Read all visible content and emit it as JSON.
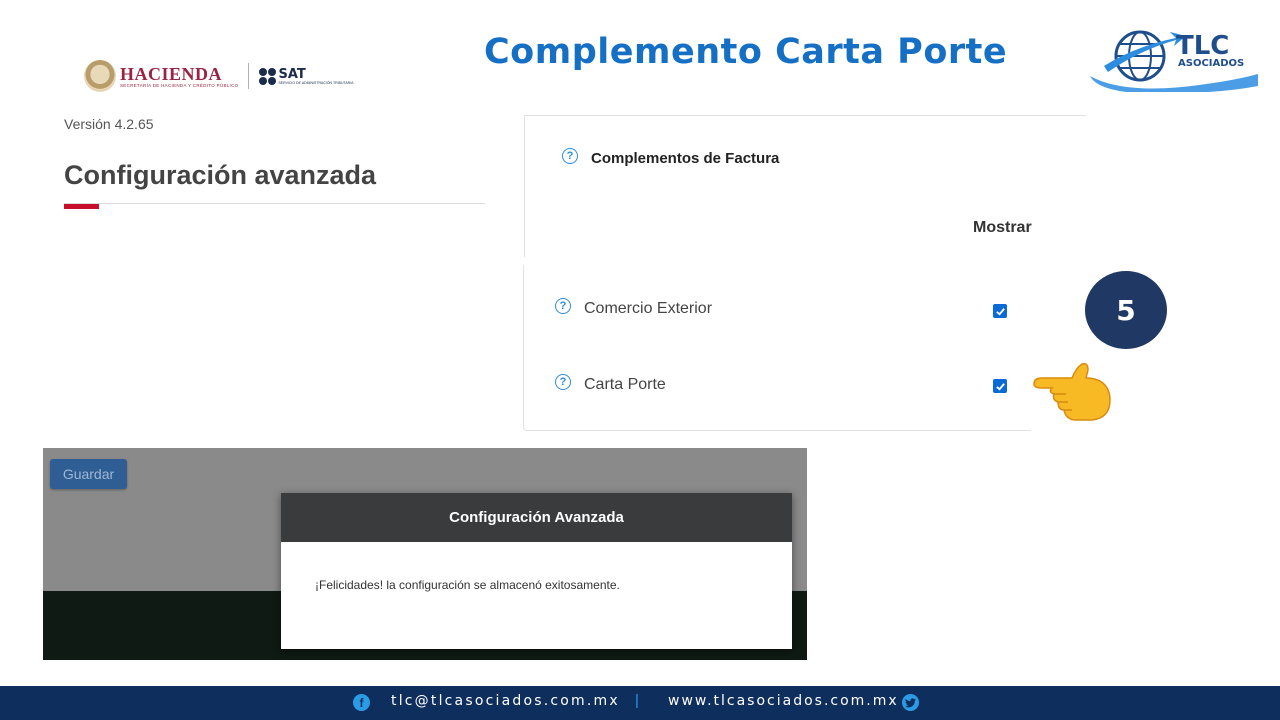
{
  "slide": {
    "title": "Complemento Carta Porte",
    "step_number": "5"
  },
  "logos": {
    "hacienda_name": "HACIENDA",
    "hacienda_sub": "SECRETARÍA DE HACIENDA Y CRÉDITO PÚBLICO",
    "sat_name": "SAT",
    "sat_sub": "SERVICIO DE ADMINISTRACIÓN TRIBUTARIA",
    "tlc_name": "TLC",
    "tlc_sub": "ASOCIADOS"
  },
  "config": {
    "version": "Versión 4.2.65",
    "title": "Configuración avanzada"
  },
  "panel": {
    "title": "Complementos de Factura",
    "column_header": "Mostrar",
    "rows": [
      {
        "label": "Comercio Exterior",
        "checked": true
      },
      {
        "label": "Carta Porte",
        "checked": true
      }
    ]
  },
  "screenshot": {
    "save_button": "Guardar",
    "modal_title": "Configuración Avanzada",
    "modal_message": "¡Felicidades! la configuración se almacenó exitosamente."
  },
  "footer": {
    "email": "tlc@tlcasociados.com.mx",
    "separator": "|",
    "website": "www.tlcasociados.com.mx",
    "facebook_icon": "f"
  },
  "colors": {
    "title_blue": "#1570c5",
    "accent_red": "#c8102e",
    "checkbox_blue": "#0b6bd6",
    "badge_navy": "#1f3864",
    "footer_navy": "#0e2e5e"
  },
  "icons": [
    "help-circle-icon",
    "checkbox-checked-icon",
    "pointing-hand-icon",
    "facebook-icon",
    "twitter-icon",
    "globe-icon"
  ]
}
